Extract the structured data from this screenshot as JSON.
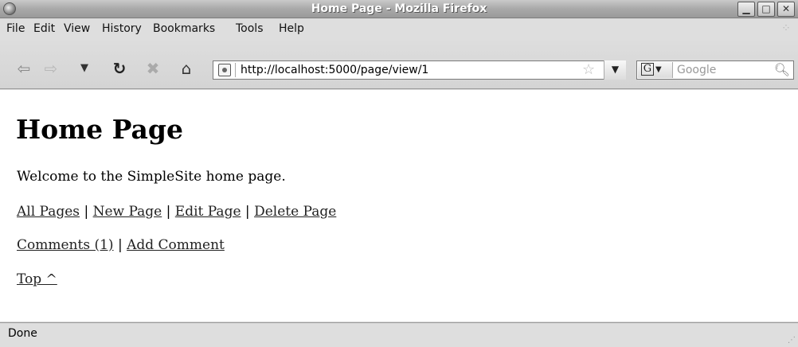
{
  "window": {
    "title": "Home Page - Mozilla Firefox",
    "min_glyph": "▁",
    "max_glyph": "□",
    "close_glyph": "✕"
  },
  "menu": [
    "File",
    "Edit",
    "View",
    "History",
    "Bookmarks",
    "Tools",
    "Help"
  ],
  "toolbar": {
    "url": "http://localhost:5000/page/view/1",
    "search_placeholder": "Google",
    "search_engine_letter": "G"
  },
  "page": {
    "heading": "Home Page",
    "welcome": "Welcome to the SimpleSite home page.",
    "links_row1": [
      "All Pages",
      "New Page",
      "Edit Page",
      "Delete Page"
    ],
    "links_row2": [
      "Comments (1)",
      "Add Comment"
    ],
    "separator": "|",
    "top_link": "Top ^"
  },
  "status": {
    "text": "Done"
  }
}
